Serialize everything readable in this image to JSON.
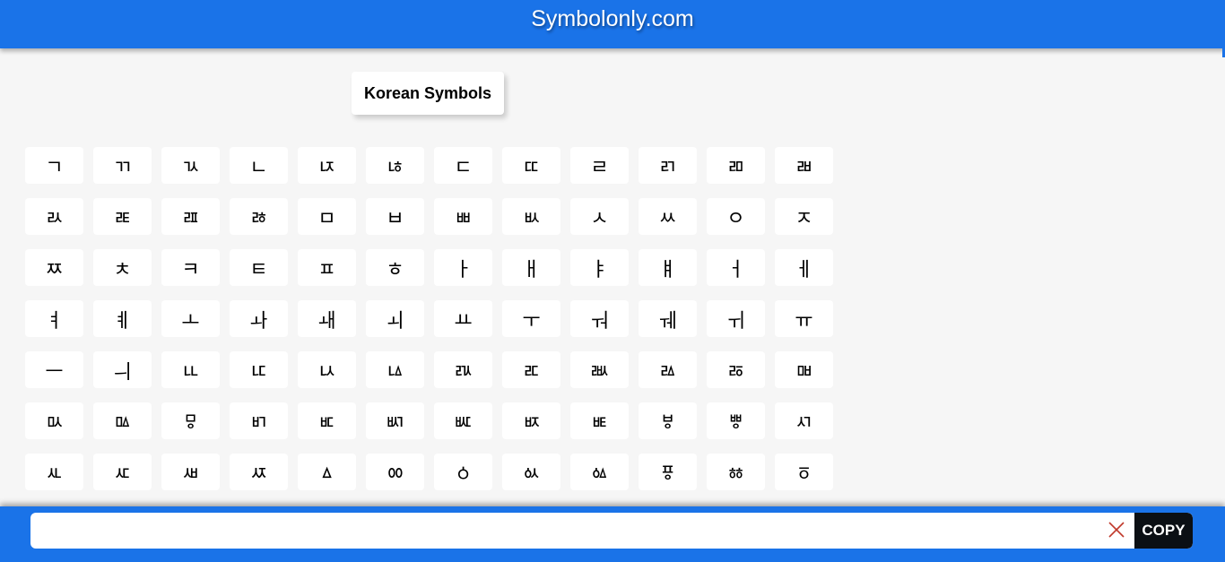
{
  "header": {
    "title": "Symbolonly.com"
  },
  "category": {
    "title": "Korean Symbols"
  },
  "symbols": [
    "ㄱ",
    "ㄲ",
    "ㄳ",
    "ㄴ",
    "ㄵ",
    "ㄶ",
    "ㄷ",
    "ㄸ",
    "ㄹ",
    "ㄺ",
    "ㄻ",
    "ㄼ",
    "ㄽ",
    "ㄾ",
    "ㄿ",
    "ㅀ",
    "ㅁ",
    "ㅂ",
    "ㅃ",
    "ㅄ",
    "ㅅ",
    "ㅆ",
    "ㅇ",
    "ㅈ",
    "ㅉ",
    "ㅊ",
    "ㅋ",
    "ㅌ",
    "ㅍ",
    "ㅎ",
    "ㅏ",
    "ㅐ",
    "ㅑ",
    "ㅒ",
    "ㅓ",
    "ㅔ",
    "ㅕ",
    "ㅖ",
    "ㅗ",
    "ㅘ",
    "ㅙ",
    "ㅚ",
    "ㅛ",
    "ㅜ",
    "ㅝ",
    "ㅞ",
    "ㅟ",
    "ㅠ",
    "ㅡ",
    "ㅢ",
    "ㅥ",
    "ㅦ",
    "ㅧ",
    "ㅨ",
    "ㅩ",
    "ㅪ",
    "ㅫ",
    "ㅬ",
    "ㅭ",
    "ㅮ",
    "ㅯ",
    "ㅰ",
    "ㅱ",
    "ㅲ",
    "ㅳ",
    "ㅴ",
    "ㅵ",
    "ㅶ",
    "ㅷ",
    "ㅸ",
    "ㅹ",
    "ㅺ",
    "ㅻ",
    "ㅼ",
    "ㅽ",
    "ㅾ",
    "ㅿ",
    "ㆀ",
    "ㆁ",
    "ㆂ",
    "ㆃ",
    "ㆄ",
    "ㆅ",
    "ㆆ"
  ],
  "copy_bar": {
    "input_value": "",
    "input_placeholder": "",
    "clear_icon": "close-icon",
    "copy_label": "COPY",
    "clear_color": "#c0392b"
  },
  "colors": {
    "brand": "#1a73e8",
    "background": "#f6f6f6",
    "copy_button": "#0b0f14"
  }
}
